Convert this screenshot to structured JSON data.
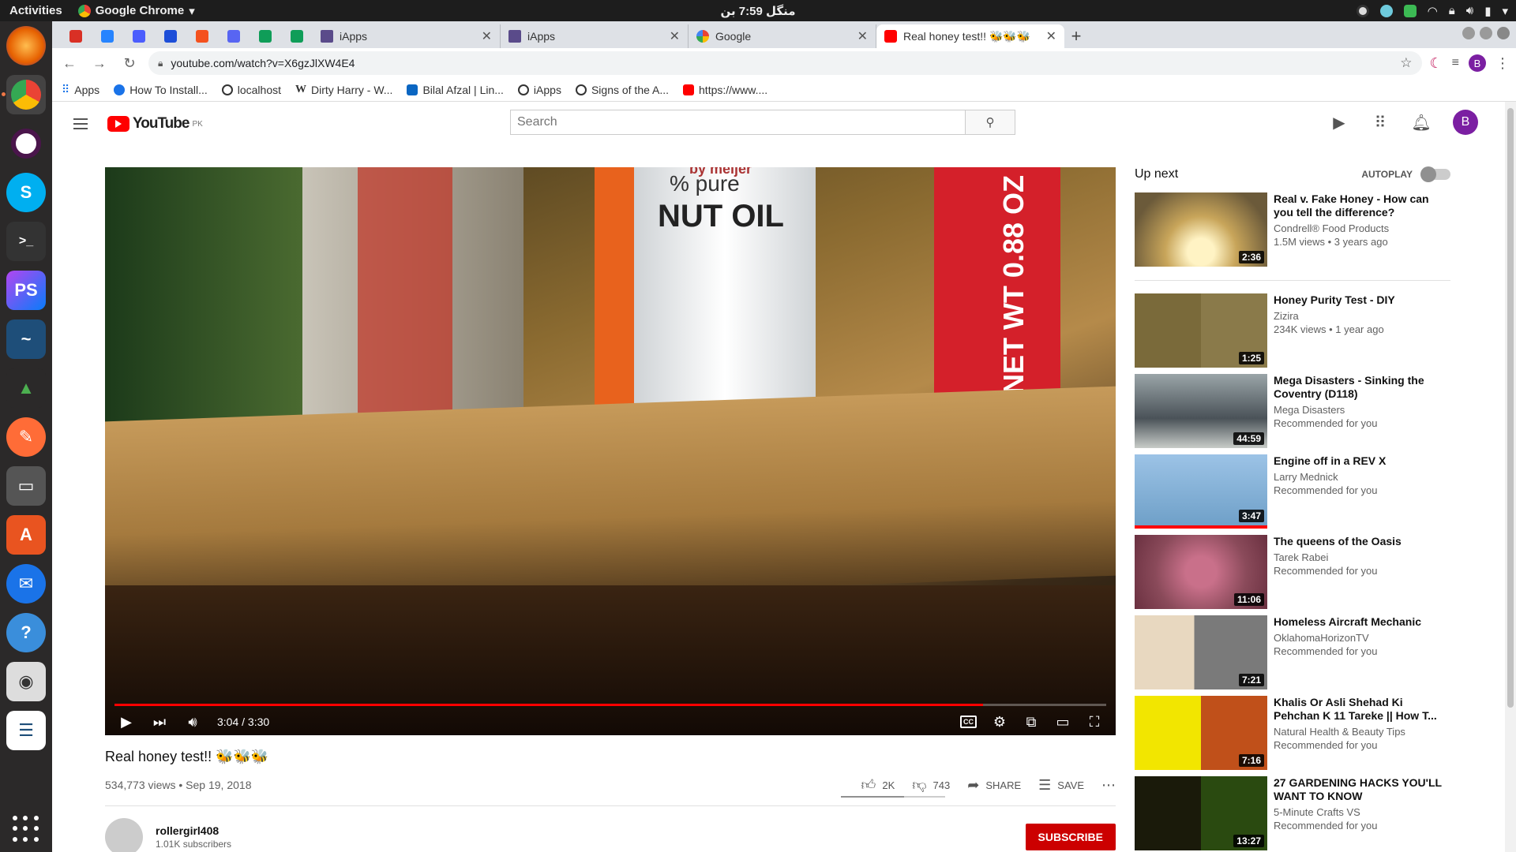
{
  "os": {
    "activities": "Activities",
    "app_name": "Google Chrome",
    "clock": "منگل 7:59 بن"
  },
  "browser": {
    "tabs": [
      {
        "title": "iApps"
      },
      {
        "title": "iApps"
      },
      {
        "title": "Google"
      },
      {
        "title": "Real honey test!! 🐝🐝🐝"
      }
    ],
    "url": "youtube.com/watch?v=X6gzJlXW4E4",
    "profile_initial": "B",
    "bookmarks": [
      {
        "label": "Apps"
      },
      {
        "label": "How To Install..."
      },
      {
        "label": "localhost"
      },
      {
        "label": "Dirty Harry - W..."
      },
      {
        "label": "Bilal Afzal | Lin..."
      },
      {
        "label": "iApps"
      },
      {
        "label": "Signs of the A..."
      },
      {
        "label": "https://www...."
      }
    ]
  },
  "youtube": {
    "logo_text": "YouTube",
    "region": "PK",
    "search_placeholder": "Search",
    "avatar_initial": "B",
    "player": {
      "scene_text_top": "by meijer",
      "scene_text_jar": "NUT OIL",
      "scene_text_pure": "% pure",
      "scene_text_bag": "NET WT 0.88 OZ",
      "time": "3:04 / 3:30",
      "progress_fraction": 0.876
    },
    "video": {
      "title": "Real honey test!! 🐝🐝🐝",
      "views_date": "534,773 views • Sep 19, 2018",
      "likes": "2K",
      "dislikes": "743",
      "share": "SHARE",
      "save": "SAVE"
    },
    "channel": {
      "name": "rollergirl408",
      "subscribers": "1.01K subscribers",
      "subscribe_label": "SUBSCRIBE"
    },
    "sidebar": {
      "up_next": "Up next",
      "autoplay": "AUTOPLAY",
      "items": [
        {
          "title": "Real v. Fake Honey - How can you tell the difference?",
          "channel": "Condrell® Food Products",
          "meta": "1.5M views • 3 years ago",
          "duration": "2:36"
        },
        {
          "title": "Honey Purity Test - DIY",
          "channel": "Zizira",
          "meta": "234K views • 1 year ago",
          "duration": "1:25"
        },
        {
          "title": "Mega Disasters - Sinking the Coventry (D118)",
          "channel": "Mega Disasters",
          "meta": "Recommended for you",
          "duration": "44:59"
        },
        {
          "title": "Engine off in a REV X",
          "channel": "Larry Mednick",
          "meta": "Recommended for you",
          "duration": "3:47"
        },
        {
          "title": "The queens of the Oasis",
          "channel": "Tarek Rabei",
          "meta": "Recommended for you",
          "duration": "11:06"
        },
        {
          "title": "Homeless Aircraft Mechanic",
          "channel": "OklahomaHorizonTV",
          "meta": "Recommended for you",
          "duration": "7:21"
        },
        {
          "title": "Khalis Or Asli Shehad Ki Pehchan K 11 Tareke || How T...",
          "channel": "Natural Health & Beauty Tips",
          "meta": "Recommended for you",
          "duration": "7:16"
        },
        {
          "title": "27 GARDENING HACKS YOU'LL WANT TO KNOW",
          "channel": "5-Minute Crafts VS",
          "meta": "Recommended for you",
          "duration": "13:27"
        }
      ]
    }
  }
}
